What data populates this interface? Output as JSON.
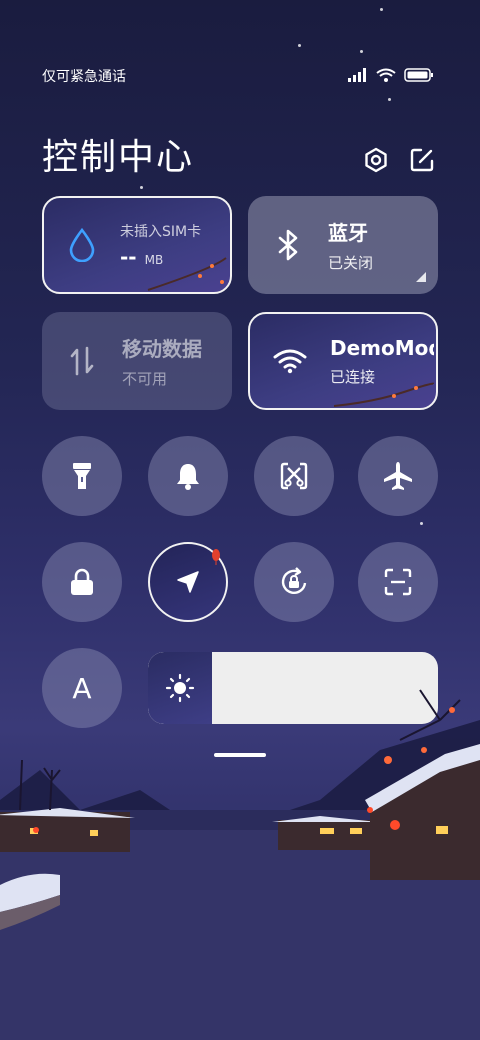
{
  "status_bar": {
    "carrier_text": "仅可紧急通话"
  },
  "header": {
    "title": "控制中心"
  },
  "tiles": {
    "mobile_data_usage": {
      "title": "未插入SIM卡",
      "value": "--",
      "unit": "MB"
    },
    "bluetooth": {
      "title": "蓝牙",
      "status": "已关闭"
    },
    "cellular": {
      "title": "移动数据",
      "status": "不可用"
    },
    "wifi": {
      "title": "DemoMod",
      "status": "已连接"
    }
  },
  "buttons_row1": [
    "flashlight-icon",
    "bell-icon",
    "screenshot-icon",
    "airplane-icon"
  ],
  "buttons_row2": [
    "lock-icon",
    "location-icon",
    "rotation-lock-icon",
    "scan-icon"
  ],
  "font_button": {
    "label": "A"
  },
  "brightness": {
    "level": 0.22
  },
  "colors": {
    "tile_active_border": "#f2f2f2",
    "wifi_accent": "#ffffff",
    "water_drop": "#3ea0ff"
  }
}
